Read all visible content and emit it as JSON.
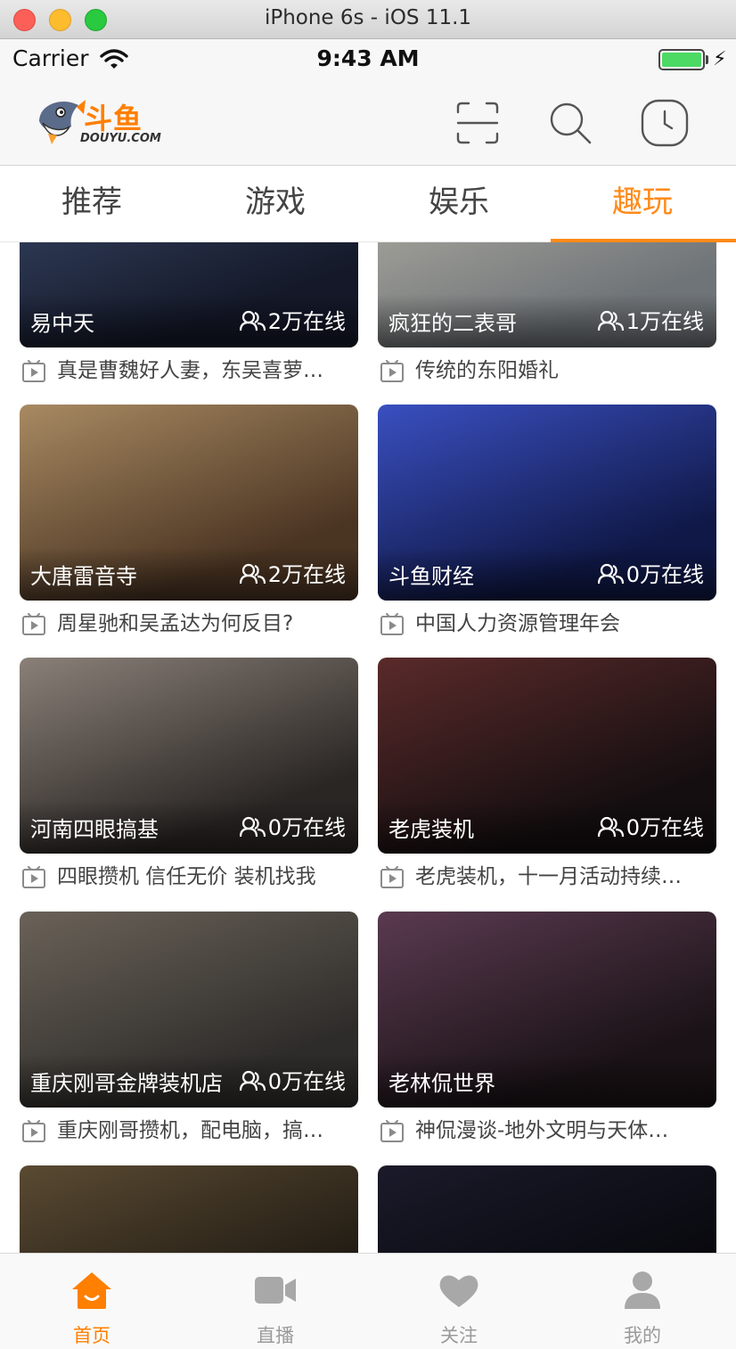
{
  "window": {
    "title": "iPhone 6s - iOS 11.1"
  },
  "status_bar": {
    "carrier": "Carrier",
    "time": "9:43 AM"
  },
  "header": {
    "logo_text": "斗鱼",
    "logo_subtext": "DOUYU.COM",
    "icons": [
      "scan-icon",
      "search-icon",
      "history-icon"
    ]
  },
  "tabs": [
    {
      "label": "推荐",
      "active": false
    },
    {
      "label": "游戏",
      "active": false
    },
    {
      "label": "娱乐",
      "active": false
    },
    {
      "label": "趣玩",
      "active": true
    }
  ],
  "feed": [
    {
      "anchor": "易中天",
      "online": "2万在线",
      "title": "真是曹魏好人妻，东吴喜萝…",
      "colors": [
        "#141828",
        "#3a4a6a"
      ]
    },
    {
      "anchor": "疯狂的二表哥",
      "online": "1万在线",
      "title": "传统的东阳婚礼",
      "colors": [
        "#6f7478",
        "#b8b4a8"
      ]
    },
    {
      "anchor": "大唐雷音寺",
      "online": "2万在线",
      "title": "周星驰和吴孟达为何反目?",
      "colors": [
        "#4a3422",
        "#a88a62"
      ]
    },
    {
      "anchor": "斗鱼财经",
      "online": "0万在线",
      "title": "中国人力资源管理年会",
      "colors": [
        "#0f1846",
        "#3a4fc0"
      ]
    },
    {
      "anchor": "河南四眼搞基",
      "online": "0万在线",
      "title": "四眼攒机 信任无价 装机找我",
      "colors": [
        "#2a2624",
        "#8a8078"
      ]
    },
    {
      "anchor": "老虎装机",
      "online": "0万在线",
      "title": "老虎装机，十一月活动持续…",
      "colors": [
        "#140e10",
        "#5a2a2a"
      ]
    },
    {
      "anchor": "重庆刚哥金牌装机店",
      "online": "0万在线",
      "title": "重庆刚哥攒机，配电脑，搞…",
      "colors": [
        "#2e2c2a",
        "#6a6258"
      ]
    },
    {
      "anchor": "老林侃世界",
      "online": "",
      "title": "神侃漫谈-地外文明与天体…",
      "colors": [
        "#1a1216",
        "#5a3a50"
      ]
    },
    {
      "anchor": "",
      "online": "",
      "title": "",
      "colors": [
        "#1a1610",
        "#5a4a32"
      ]
    },
    {
      "anchor": "",
      "online": "",
      "title": "",
      "colors": [
        "#06060a",
        "#1a1a2a"
      ]
    }
  ],
  "tabbar": [
    {
      "label": "首页",
      "icon": "home-icon",
      "active": true
    },
    {
      "label": "直播",
      "icon": "video-camera-icon",
      "active": false
    },
    {
      "label": "关注",
      "icon": "heart-icon",
      "active": false
    },
    {
      "label": "我的",
      "icon": "profile-icon",
      "active": false
    }
  ],
  "colors": {
    "accent": "#ff8a19",
    "text": "#444444",
    "inactive": "#9a9a9a"
  }
}
